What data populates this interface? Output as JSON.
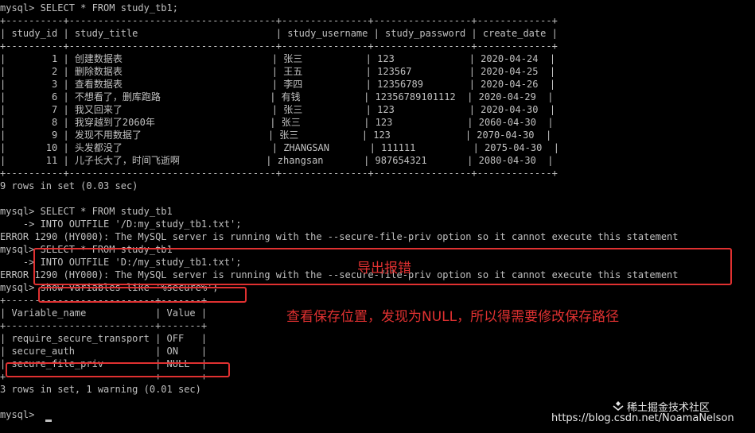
{
  "terminal": {
    "lines": [
      "mysql> SELECT * FROM study_tb1;",
      "+----------+------------------------------------+---------------+-----------------+-------------+",
      "| study_id | study_title                        | study_username | study_password | create_date |",
      "+----------+------------------------------------+---------------+-----------------+-------------+",
      "|        1 | 创建数据表                          | 张三           | 123             | 2020-04-24  |",
      "|        2 | 删除数据表                          | 王五           | 123567          | 2020-04-25  |",
      "|        3 | 查看数据表                          | 李四           | 12356789        | 2020-04-26  |",
      "|        6 | 不想看了，删库跑路                   | 有钱           | 12356789101112  | 2020-04-29  |",
      "|        7 | 我又回来了                          | 张三           | 123             | 2020-04-30  |",
      "|        8 | 我穿越到了2060年                    | 张三           | 123             | 2060-04-30  |",
      "|        9 | 发现不用数据了                      | 张三           | 123             | 2070-04-30  |",
      "|       10 | 头发都没了                          | ZHANGSAN       | 111111          | 2075-04-30  |",
      "|       11 | 儿子长大了，时间飞逝啊               | zhangsan       | 987654321       | 2080-04-30  |",
      "+----------+------------------------------------+---------------+-----------------+-------------+",
      "9 rows in set (0.03 sec)",
      "",
      "mysql> SELECT * FROM study_tb1",
      "    -> INTO OUTFILE '/D:my_study_tb1.txt';",
      "ERROR 1290 (HY000): The MySQL server is running with the --secure-file-priv option so it cannot execute this statement",
      "mysql> SELECT * FROM study_tb1",
      "    -> INTO OUTFILE 'D:/my_study_tb1.txt';",
      "ERROR 1290 (HY000): The MySQL server is running with the --secure-file-priv option so it cannot execute this statement",
      "mysql> show variables like '%secure%';",
      "+--------------------------+-------+",
      "| Variable_name            | Value |",
      "+--------------------------+-------+",
      "| require_secure_transport | OFF   |",
      "| secure_auth              | ON    |",
      "| secure_file_priv         | NULL  |",
      "+--------------------------+-------+",
      "3 rows in set, 1 warning (0.01 sec)",
      "",
      "mysql> "
    ]
  },
  "annotations": {
    "export_error": "导出报错",
    "check_location": "查看保存位置，发现为NULL，所以得需要修改保存路径"
  },
  "watermark": {
    "site": "稀土掘金技术社区",
    "url": "https://blog.csdn.net/NoamaNelson"
  }
}
